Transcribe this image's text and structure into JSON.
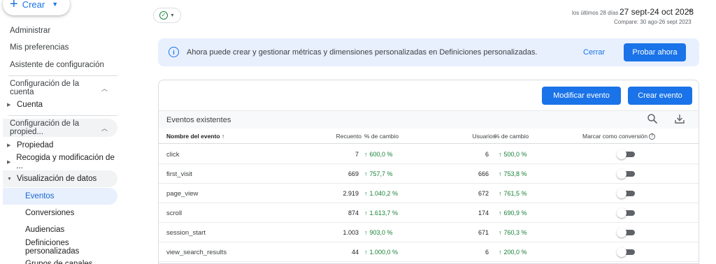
{
  "sidebar": {
    "create_label": "Crear",
    "items": {
      "admin": "Administrar",
      "prefs": "Mis preferencias",
      "assistant": "Asistente de configuración"
    },
    "account_section": "Configuración de la cuenta",
    "account_sub": "Cuenta",
    "property_section": "Configuración de la propied...",
    "property_subs": {
      "property": "Propiedad",
      "collection": "Recogida y modificación de ...",
      "display": "Visualización de datos"
    },
    "leaves": {
      "events": "Eventos",
      "conversions": "Conversiones",
      "audiences": "Audiencias",
      "custom_defs": "Definiciones personalizadas",
      "channel_groups": "Grupos de canales"
    }
  },
  "topbar": {
    "date_prefix": "los últimos 28 días",
    "date_range": "27 sept-24 oct 2023",
    "compare": "Compare: 30 ago-26 sept 2023"
  },
  "banner": {
    "message": "Ahora puede crear y gestionar métricas y dimensiones personalizadas en Definiciones personalizadas.",
    "close": "Cerrar",
    "try_now": "Probar ahora"
  },
  "card": {
    "modify_event": "Modificar evento",
    "create_event": "Crear evento",
    "title": "Eventos existentes",
    "columns": {
      "name": "Nombre del evento",
      "count": "Recuento",
      "count_change": "% de cambio",
      "users": "Usuarios",
      "users_change": "% de cambio",
      "conversion": "Marcar como conversión"
    },
    "rows": [
      {
        "name": "click",
        "count": "7",
        "count_change": "600,0 %",
        "users": "6",
        "users_change": "500,0 %",
        "conversion": false
      },
      {
        "name": "first_visit",
        "count": "669",
        "count_change": "757,7 %",
        "users": "666",
        "users_change": "753,8 %",
        "conversion": false
      },
      {
        "name": "page_view",
        "count": "2.919",
        "count_change": "1.040,2 %",
        "users": "672",
        "users_change": "761,5 %",
        "conversion": false
      },
      {
        "name": "scroll",
        "count": "874",
        "count_change": "1.613,7 %",
        "users": "174",
        "users_change": "690,9 %",
        "conversion": false
      },
      {
        "name": "session_start",
        "count": "1.003",
        "count_change": "903,0 %",
        "users": "671",
        "users_change": "760,3 %",
        "conversion": false
      },
      {
        "name": "view_search_results",
        "count": "44",
        "count_change": "1.000,0 %",
        "users": "6",
        "users_change": "200,0 %",
        "conversion": false
      }
    ]
  },
  "colors": {
    "primary": "#1a73e8",
    "positive": "#188038",
    "banner_bg": "#e8f0fe"
  }
}
